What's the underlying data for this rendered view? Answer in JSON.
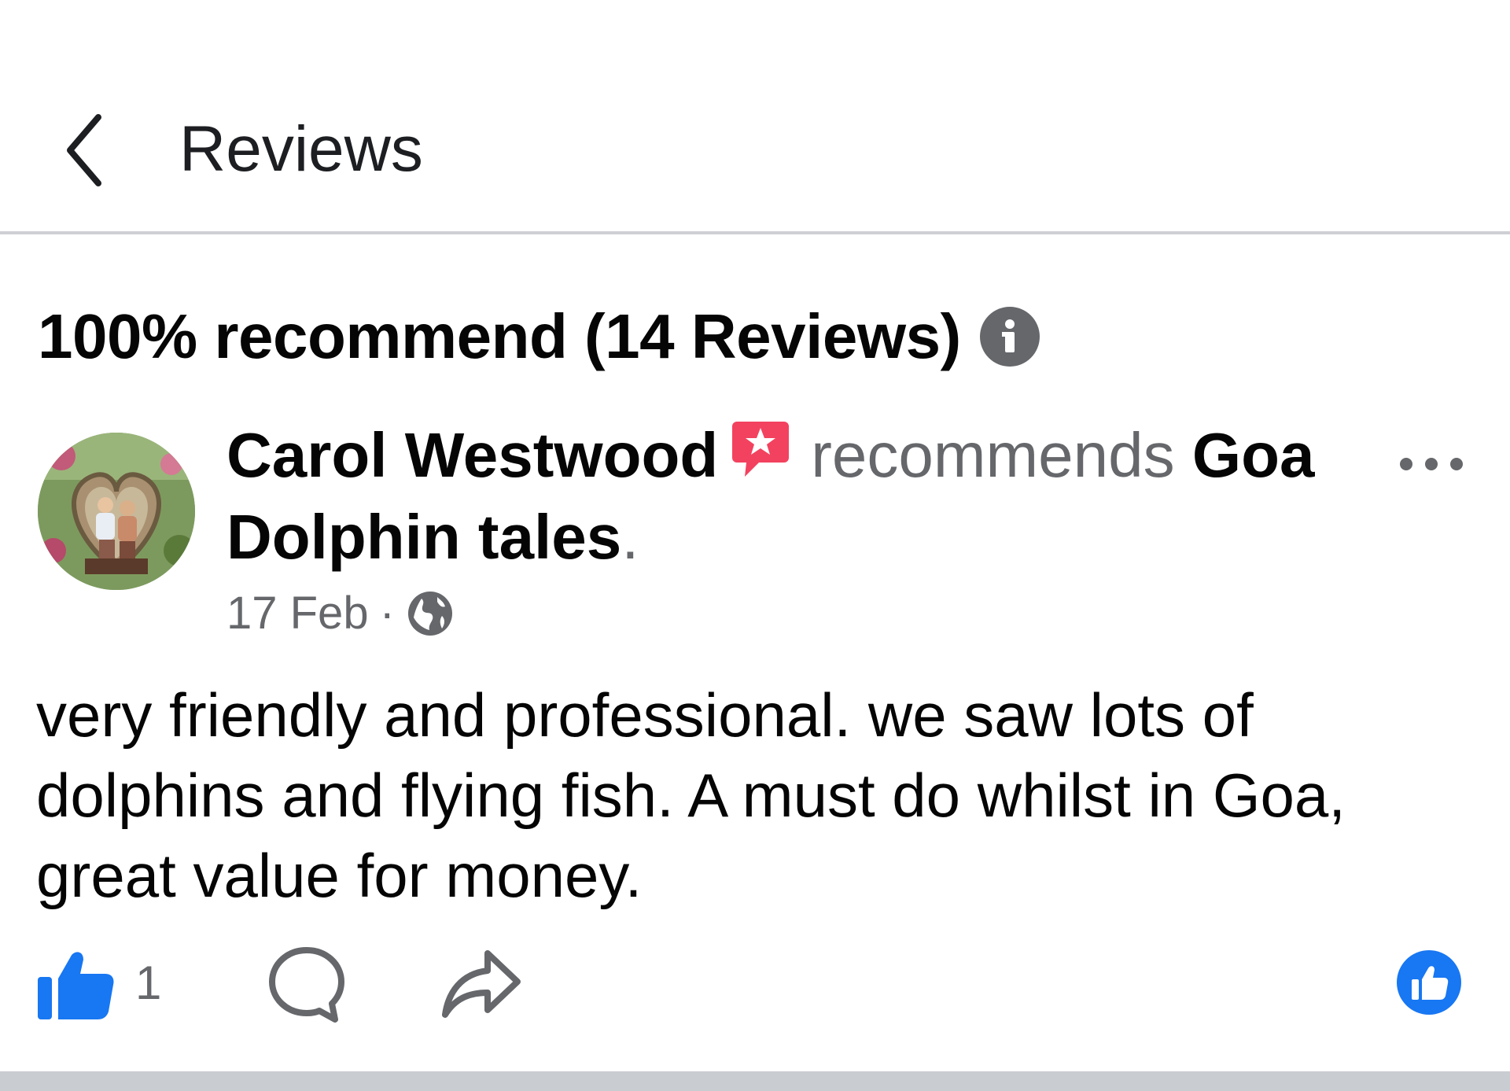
{
  "header": {
    "title": "Reviews"
  },
  "summary": {
    "text": "100% recommend (14 Reviews)"
  },
  "review": {
    "author": "Carol Westwood",
    "verb": "recommends",
    "page": "Goa Dolphin tales",
    "period": ".",
    "date": "17 Feb",
    "separator": "·",
    "body": "very friendly and professional. we saw lots of dolphins and flying fish. A must do whilst in Goa, great value for money.",
    "like_count": "1"
  },
  "colors": {
    "accent": "#1877f2",
    "badge_pink": "#f3425f",
    "secondary_text": "#65676b",
    "divider": "#ced0d4"
  },
  "icons": {
    "back": "chevron-left-icon",
    "info": "info-icon",
    "recommend_badge": "recommend-star-icon",
    "more": "more-horizontal-icon",
    "privacy": "globe-icon",
    "like": "thumbs-up-icon",
    "comment": "comment-bubble-icon",
    "share": "share-arrow-icon",
    "reaction": "like-reaction-icon"
  }
}
